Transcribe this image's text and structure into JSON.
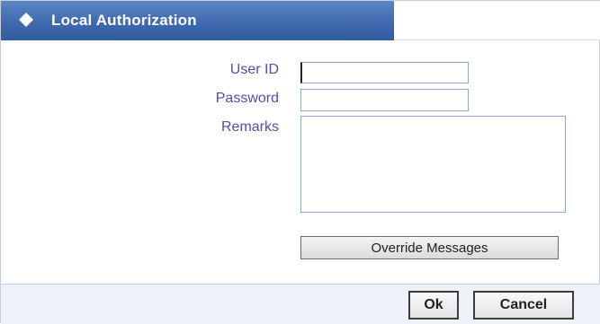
{
  "dialog": {
    "title": "Local Authorization",
    "title_icon": "diamond-icon"
  },
  "form": {
    "user_id_label": "User ID",
    "user_id_value": "",
    "password_label": "Password",
    "password_value": "",
    "remarks_label": "Remarks",
    "remarks_value": ""
  },
  "buttons": {
    "override_label": "Override Messages",
    "ok_label": "Ok",
    "cancel_label": "Cancel"
  },
  "colors": {
    "titlebar": "#3f6aad",
    "label_text": "#5a4aa8",
    "footer_bg": "#eef2f8"
  }
}
